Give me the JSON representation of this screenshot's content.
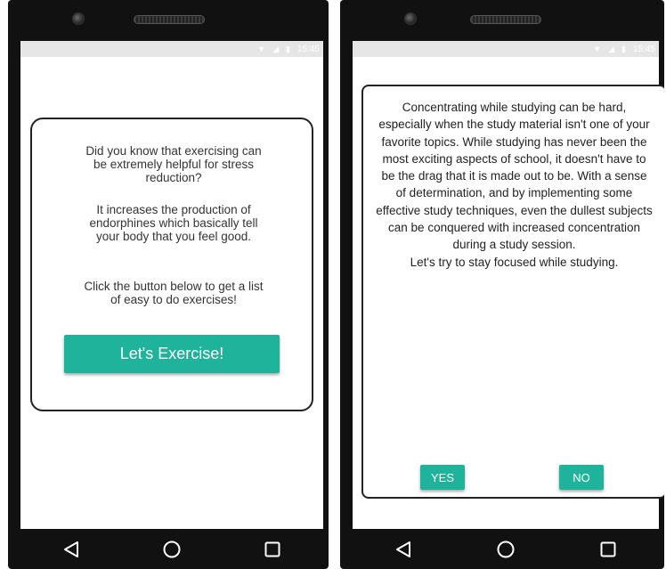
{
  "left_phone": {
    "status_time": "15:45",
    "dialog": {
      "paragraph1": "Did you know that exercising can be extremely helpful for stress reduction?",
      "paragraph2": "It increases the production of endorphines which basically tell your body that you feel good.",
      "paragraph3": "Click the button below to get a list of easy to do exercises!",
      "button_label": "Let's Exercise!"
    }
  },
  "right_phone": {
    "status_time": "15:45",
    "dialog": {
      "body": "Concentrating while studying can be hard, especially when the study material isn't one of your favorite topics. While studying has never been the most exciting aspects of school, it doesn't have to be the drag that it is made out to be. With a sense of determination, and by implementing some effective study techniques, even the dullest subjects can be conquered with increased concentration during a study session.",
      "prompt": "Let's try to stay focused while studying.",
      "yes_label": "YES",
      "no_label": "NO"
    }
  },
  "icons": {
    "status": [
      "wifi-icon",
      "signal-icon",
      "battery-icon"
    ],
    "navigation": [
      "back-icon",
      "home-icon",
      "recents-icon"
    ]
  },
  "colors": {
    "accent": "#20b39b",
    "bezel": "#111111",
    "status_bar": "#e6e6e6"
  }
}
